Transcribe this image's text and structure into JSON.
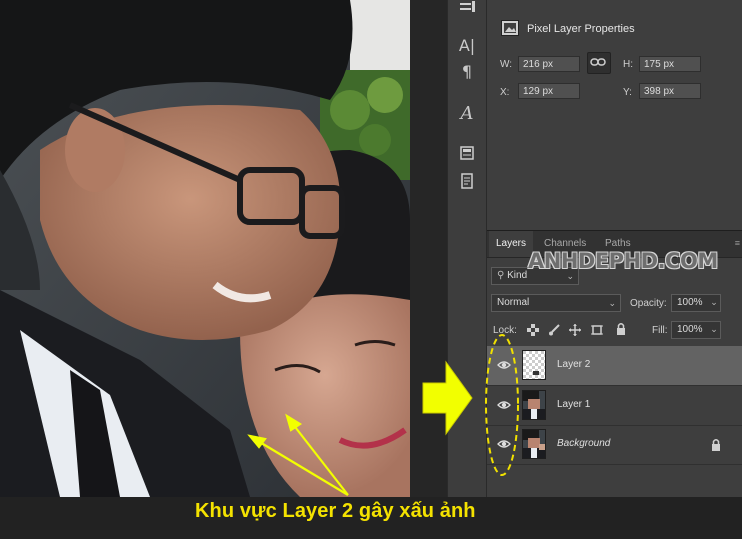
{
  "properties_panel": {
    "title": "Pixel Layer Properties",
    "w_label": "W:",
    "w_value": "216 px",
    "h_label": "H:",
    "h_value": "175 px",
    "x_label": "X:",
    "x_value": "129 px",
    "y_label": "Y:",
    "y_value": "398 px",
    "link_icon": "link-icon"
  },
  "layers_panel": {
    "tabs": [
      "Layers",
      "Channels",
      "Paths"
    ],
    "filter_label": "Kind",
    "blend_mode": "Normal",
    "opacity_label": "Opacity:",
    "opacity_value": "100%",
    "lock_label": "Lock:",
    "fill_label": "Fill:",
    "fill_value": "100%",
    "layers": [
      {
        "name": "Layer 2",
        "visible": true,
        "selected": true
      },
      {
        "name": "Layer 1",
        "visible": true,
        "selected": false
      },
      {
        "name": "Background",
        "visible": true,
        "selected": false,
        "locked": true
      }
    ]
  },
  "watermark": "ANHDEPHD.COM",
  "caption": "Khu vực Layer 2 gây xấu ảnh",
  "colors": {
    "caption": "#f4e200",
    "arrow": "#f2ff00",
    "accent_dashes": "#f0e000"
  }
}
